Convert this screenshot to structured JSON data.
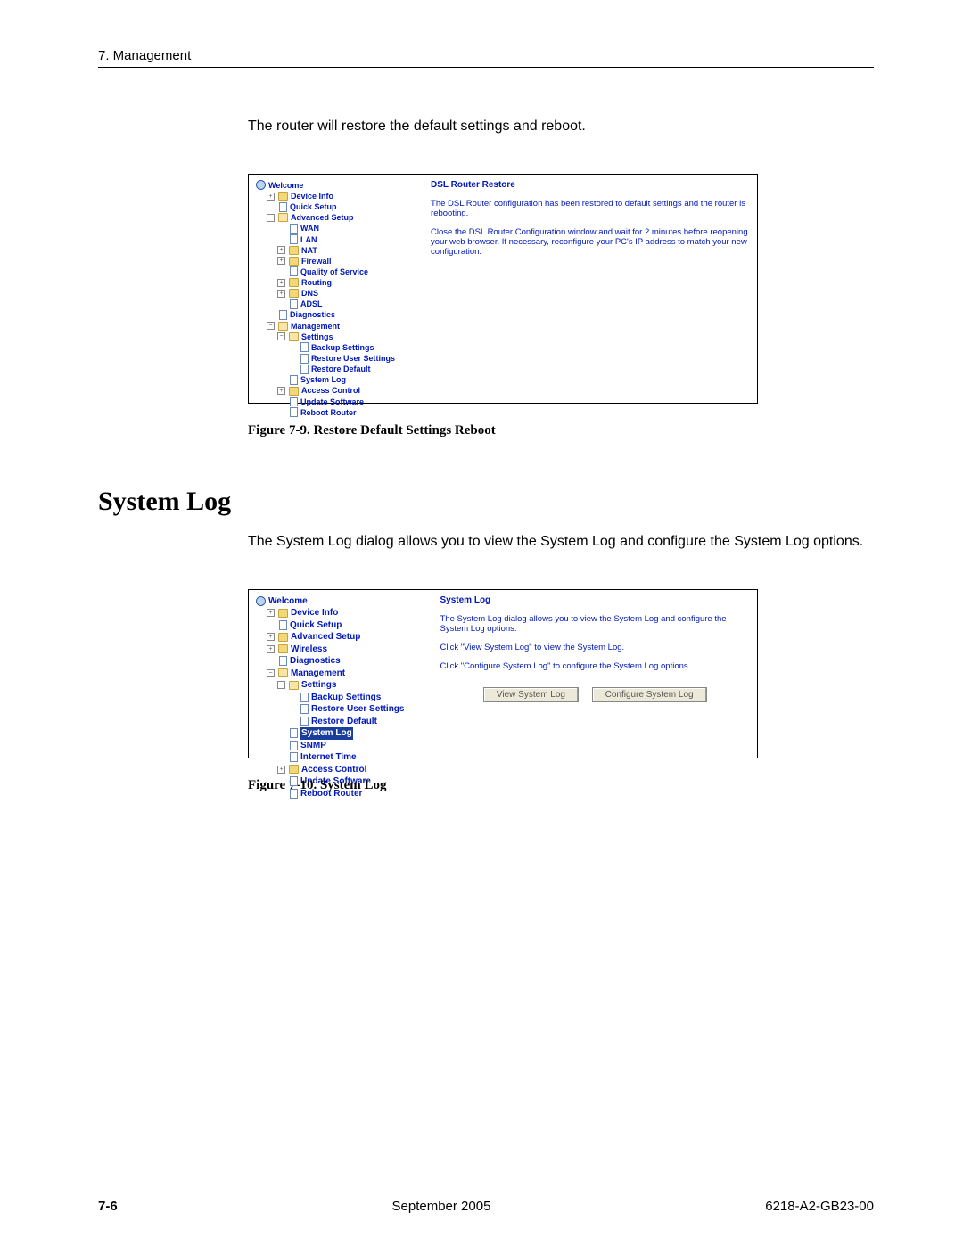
{
  "header": {
    "chapter": "7. Management"
  },
  "intro_text": "The router will restore the default settings and reboot.",
  "figure1": {
    "caption": "Figure 7-9.    Restore Default Settings Reboot",
    "tree": {
      "welcome": "Welcome",
      "device_info": "Device Info",
      "quick_setup": "Quick Setup",
      "advanced_setup": "Advanced Setup",
      "wan": "WAN",
      "lan": "LAN",
      "nat": "NAT",
      "firewall": "Firewall",
      "qos": "Quality of Service",
      "routing": "Routing",
      "dns": "DNS",
      "adsl": "ADSL",
      "diagnostics": "Diagnostics",
      "management": "Management",
      "settings": "Settings",
      "backup": "Backup Settings",
      "restore_user": "Restore User Settings",
      "restore_default": "Restore Default",
      "system_log": "System Log",
      "access_control": "Access Control",
      "update_sw": "Update Software",
      "reboot": "Reboot Router"
    },
    "content": {
      "title": "DSL Router Restore",
      "p1": "The DSL Router configuration has been restored to default settings and the router is rebooting.",
      "p2": "Close the DSL Router Configuration window and wait for 2 minutes before reopening your web browser. If necessary, reconfigure your PC's IP address to match your new configuration."
    }
  },
  "section_heading": "System Log",
  "section_text": "The System Log dialog allows you to view the System Log and configure the System Log options.",
  "figure2": {
    "caption": "Figure 7-10.   System Log",
    "tree": {
      "welcome": "Welcome",
      "device_info": "Device Info",
      "quick_setup": "Quick Setup",
      "advanced_setup": "Advanced Setup",
      "wireless": "Wireless",
      "diagnostics": "Diagnostics",
      "management": "Management",
      "settings": "Settings",
      "backup": "Backup Settings",
      "restore_user": "Restore User Settings",
      "restore_default": "Restore Default",
      "system_log": "System Log",
      "snmp": "SNMP",
      "internet_time": "Internet Time",
      "access_control": "Access Control",
      "update_sw": "Update Software",
      "reboot": "Reboot Router"
    },
    "content": {
      "title": "System Log",
      "p1": "The System Log dialog allows you to view the System Log and configure the System Log options.",
      "p2": "Click \"View System Log\" to view the System Log.",
      "p3": "Click \"Configure System Log\" to configure the System Log options.",
      "btn_view": "View System Log",
      "btn_cfg": "Configure System Log"
    }
  },
  "footer": {
    "page": "7-6",
    "date": "September 2005",
    "doc": "6218-A2-GB23-00"
  }
}
